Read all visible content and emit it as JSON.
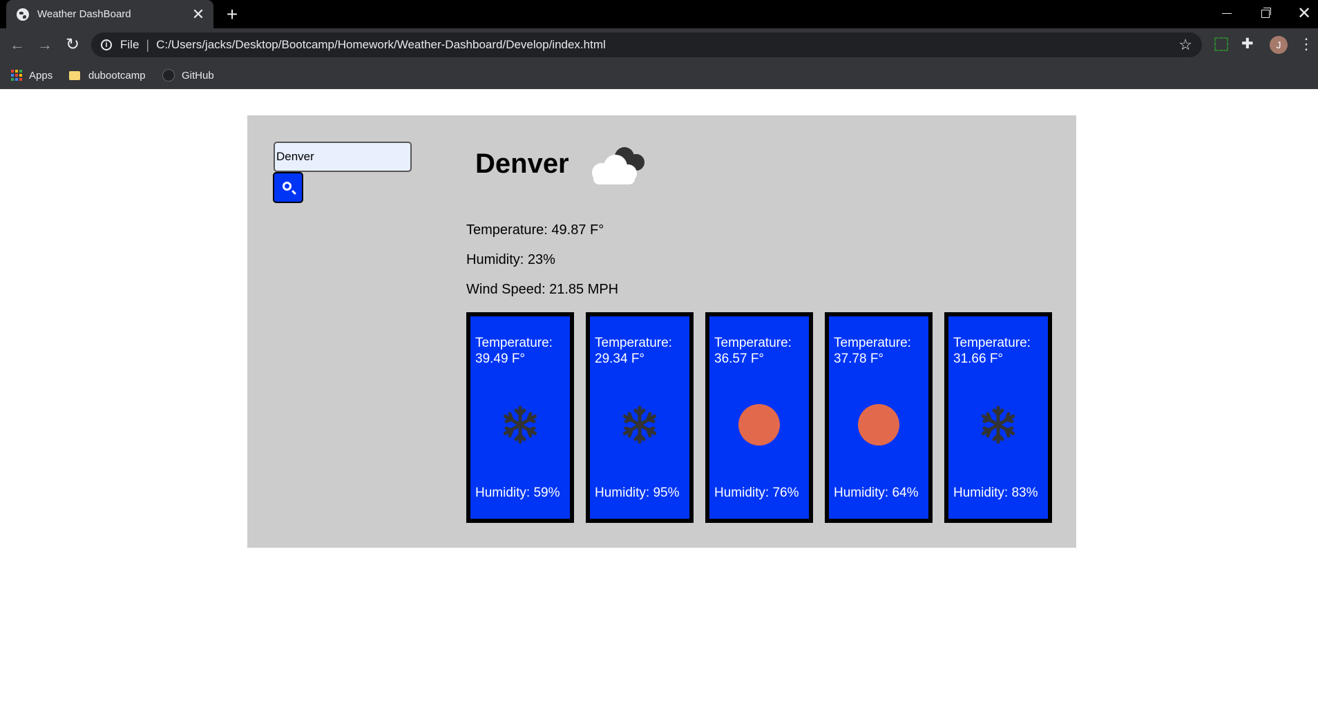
{
  "browser": {
    "tab_title": "Weather DashBoard",
    "tab_close": "✕",
    "new_tab": "+",
    "scheme": "File",
    "separator": "|",
    "url": "C:/Users/jacks/Desktop/Bootcamp/Homework/Weather-Dashboard/Develop/index.html",
    "profile_initial": "J",
    "bookmarks": [
      {
        "label": "Apps"
      },
      {
        "label": "dubootcamp"
      },
      {
        "label": "GitHub"
      }
    ]
  },
  "search": {
    "value": "Denver"
  },
  "current": {
    "city": "Denver",
    "icon": "cloud-icon",
    "temperature": "Temperature: 49.87 F°",
    "humidity": "Humidity: 23%",
    "wind_speed": "Wind Speed: 21.85 MPH"
  },
  "forecast": [
    {
      "temperature": "Temperature: 39.49 F°",
      "icon": "snowflake-icon",
      "humidity": "Humidity: 59%"
    },
    {
      "temperature": "Temperature: 29.34 F°",
      "icon": "snowflake-icon",
      "humidity": "Humidity: 95%"
    },
    {
      "temperature": "Temperature: 36.57 F°",
      "icon": "sun-icon",
      "humidity": "Humidity: 76%"
    },
    {
      "temperature": "Temperature: 37.78 F°",
      "icon": "sun-icon",
      "humidity": "Humidity: 64%"
    },
    {
      "temperature": "Temperature: 31.66 F°",
      "icon": "snowflake-icon",
      "humidity": "Humidity: 83%"
    }
  ],
  "colors": {
    "card_background": "#0035f5",
    "page_panel": "#cccccc",
    "sun": "#e2694b",
    "snowflake": "#333333"
  }
}
